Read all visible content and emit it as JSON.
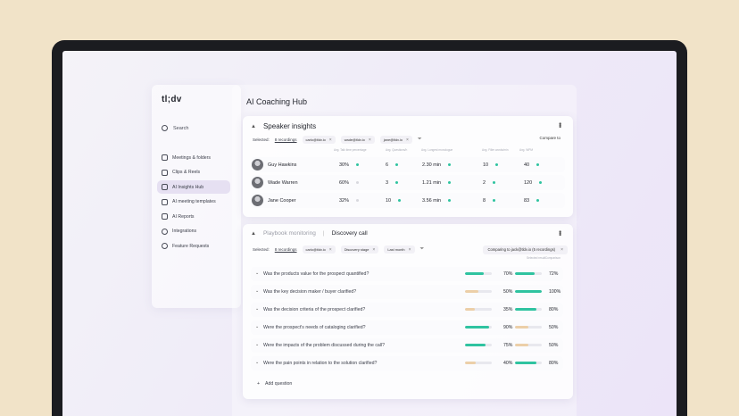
{
  "app": {
    "logo": "tl;dv",
    "title": "AI Coaching Hub"
  },
  "sidebar": {
    "search_label": "Search",
    "items": [
      {
        "label": "Meetings & folders",
        "icon": "video-icon",
        "active": false
      },
      {
        "label": "Clips & Reels",
        "icon": "clips-icon",
        "active": false
      },
      {
        "label": "AI Insights Hub",
        "icon": "insights-icon",
        "active": true
      },
      {
        "label": "AI meeting templates",
        "icon": "template-icon",
        "active": false
      },
      {
        "label": "AI Reports",
        "icon": "report-icon",
        "active": false
      },
      {
        "label": "Integrations",
        "icon": "integrations-icon",
        "active": false
      },
      {
        "label": "Feature Requests",
        "icon": "lightbulb-icon",
        "active": false
      }
    ]
  },
  "speaker_insights": {
    "title": "Speaker insights",
    "selected_label": "Selected:",
    "selected_link": "8 recordings",
    "chips": [
      "carlo@tldv.io",
      "wade@tldv.io",
      "jane@tldv.io"
    ],
    "compare_label": "Compare to",
    "column_headers": [
      "Avg. Talk time percentage",
      "Avg. Questions/h",
      "Avg. Longest monologue",
      "Avg. Filler words/min",
      "Avg. WPM"
    ],
    "rows": [
      {
        "name": "Guy Hawkins",
        "values": [
          "30%",
          "6",
          "2.30 min",
          "10",
          "40"
        ],
        "dots": [
          "teal",
          "teal",
          "teal",
          "teal",
          "teal"
        ]
      },
      {
        "name": "Wade Warren",
        "values": [
          "60%",
          "3",
          "1.21 min",
          "2",
          "120"
        ],
        "dots": [
          "grey",
          "teal",
          "teal",
          "teal",
          "teal"
        ]
      },
      {
        "name": "Jane Cooper",
        "values": [
          "32%",
          "10",
          "3.56 min",
          "8",
          "83"
        ],
        "dots": [
          "grey",
          "teal",
          "teal",
          "teal",
          "teal"
        ]
      }
    ]
  },
  "playbook": {
    "title_prefix": "Playbook monitoring",
    "separator": "|",
    "title": "Discovery call",
    "selected_label": "Selected:",
    "selected_link": "8 recordings",
    "chips": [
      "carlo@tldv.io",
      "Discovery stage",
      "Last month"
    ],
    "compare_label": "Comparing to jack@tldv.io (5 recordings)",
    "col_a": "Selected result",
    "col_b": "Comparison",
    "questions": [
      {
        "text": "Was the products value for the prospect quantified?",
        "a": "70%",
        "a_val": 0.7,
        "a_color": "#2fc3a0",
        "b": "72%",
        "b_val": 0.72,
        "b_color": "#2fc3a0"
      },
      {
        "text": "Was the key decision maker / buyer clarified?",
        "a": "50%",
        "a_val": 0.5,
        "a_color": "#eccfa8",
        "b": "100%",
        "b_val": 1.0,
        "b_color": "#2fc3a0"
      },
      {
        "text": "Was the decision criteria of the prospect clarified?",
        "a": "35%",
        "a_val": 0.35,
        "a_color": "#eccfa8",
        "b": "80%",
        "b_val": 0.8,
        "b_color": "#2fc3a0"
      },
      {
        "text": "Were the prospect's needs of cataloging clarified?",
        "a": "90%",
        "a_val": 0.9,
        "a_color": "#2fc3a0",
        "b": "50%",
        "b_val": 0.5,
        "b_color": "#eccfa8"
      },
      {
        "text": "Were the impacts of the problem discussed during the call?",
        "a": "75%",
        "a_val": 0.75,
        "a_color": "#2fc3a0",
        "b": "50%",
        "b_val": 0.5,
        "b_color": "#eccfa8"
      },
      {
        "text": "Were the pain points in relation to the solution clarified?",
        "a": "40%",
        "a_val": 0.4,
        "a_color": "#eccfa8",
        "b": "80%",
        "b_val": 0.8,
        "b_color": "#2fc3a0"
      }
    ],
    "add_question": "Add question"
  }
}
